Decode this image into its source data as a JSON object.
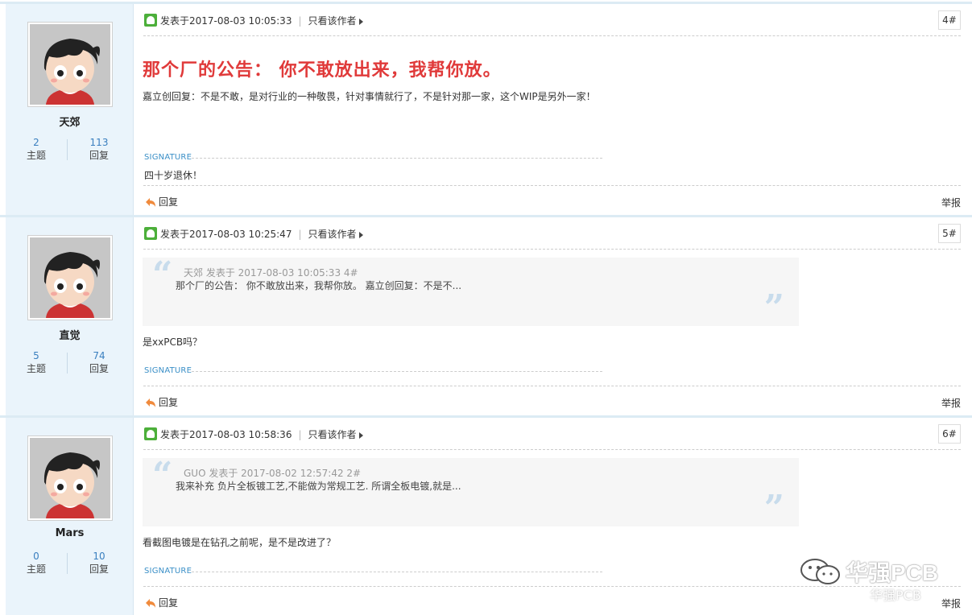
{
  "posts": [
    {
      "user": {
        "name": "天郊",
        "topics": "2",
        "topics_label": "主题",
        "replies": "113",
        "replies_label": "回复"
      },
      "posted_at": "发表于2017-08-03 10:05:33",
      "only_author": "只看该作者",
      "floor": "4#",
      "headline": "那个厂的公告： 你不敢放出来，我帮你放。",
      "body": "嘉立创回复：不是不敢，是对行业的一种敬畏，针对事情就行了，不是针对那一家，这个WIP是另外一家！",
      "signature_label": "SIGNATURE",
      "signature_text": "四十岁退休！",
      "reply_label": "回复",
      "report_label": "举报"
    },
    {
      "user": {
        "name": "直觉",
        "topics": "5",
        "topics_label": "主题",
        "replies": "74",
        "replies_label": "回复"
      },
      "posted_at": "发表于2017-08-03 10:25:47",
      "only_author": "只看该作者",
      "floor": "5#",
      "quote": {
        "head": "天郊 发表于 2017-08-03 10:05:33  4#",
        "body": "那个厂的公告： 你不敢放出来，我帮你放。 嘉立创回复：不是不..."
      },
      "body": "是xxPCB吗？",
      "signature_label": "SIGNATURE",
      "reply_label": "回复",
      "report_label": "举报"
    },
    {
      "user": {
        "name": "Mars",
        "topics": "0",
        "topics_label": "主题",
        "replies": "10",
        "replies_label": "回复"
      },
      "posted_at": "发表于2017-08-03 10:58:36",
      "only_author": "只看该作者",
      "floor": "6#",
      "quote": {
        "head": "GUO 发表于 2017-08-02 12:57:42  2#",
        "body": "我来补充 负片全板镀工艺,不能做为常规工艺. 所谓全板电镀,就是..."
      },
      "body": "看截图电镀是在钻孔之前呢，是不是改进了？",
      "signature_label": "SIGNATURE",
      "reply_label": "回复",
      "report_label": "举报"
    }
  ],
  "watermark": {
    "title": "华强PCB",
    "sub": "华强PCB",
    "icon": "wechat-icon"
  },
  "colors": {
    "accent_red": "#e03a3a",
    "link_blue": "#3a7fbf",
    "sidebar_bg": "#eaf4fb"
  }
}
